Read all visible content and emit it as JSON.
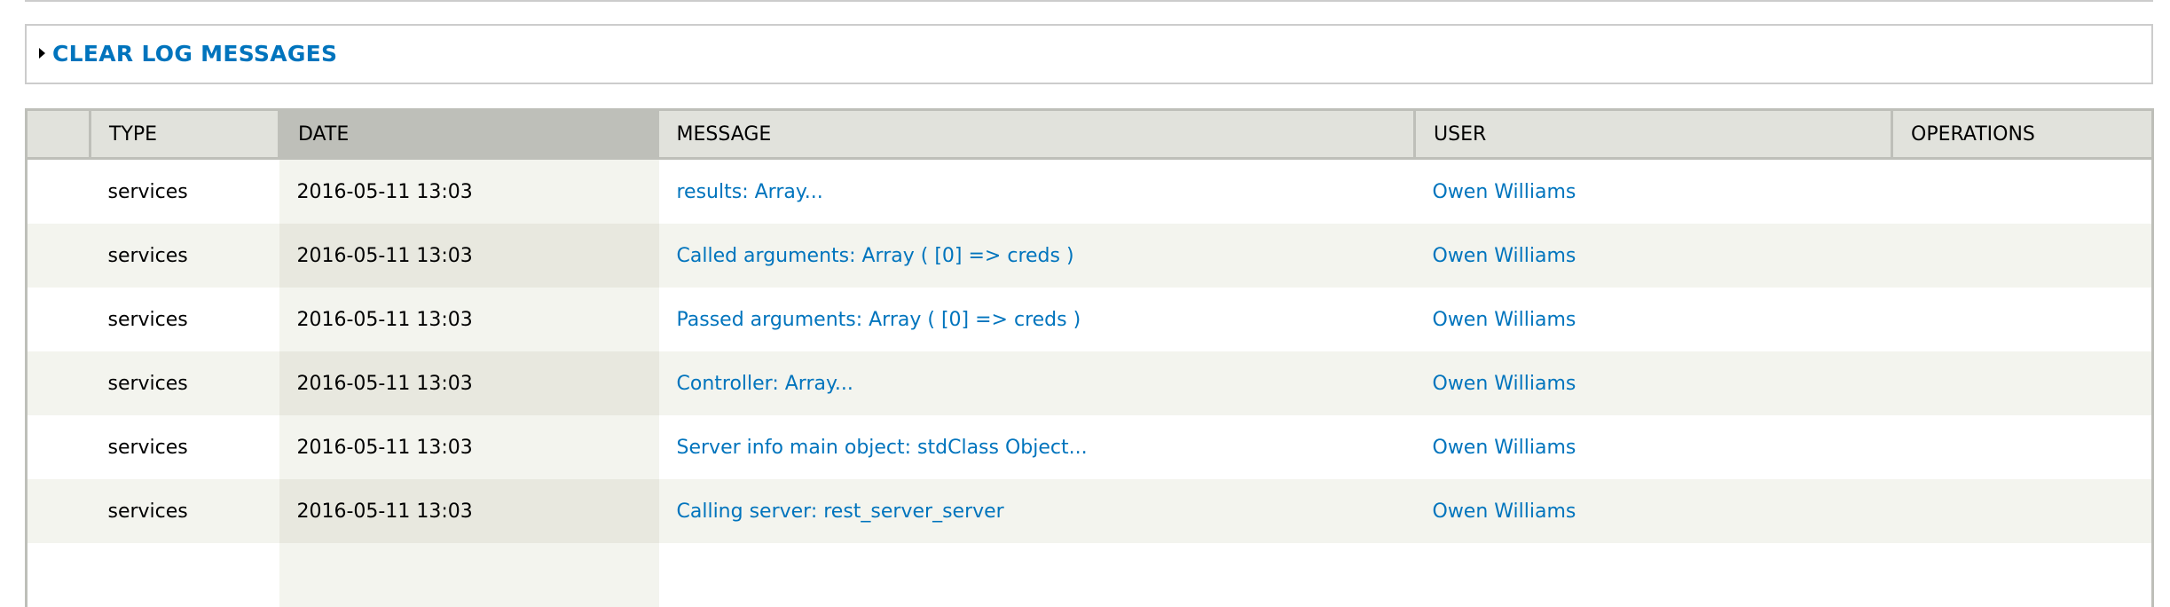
{
  "clear_log": {
    "label": "CLEAR LOG MESSAGES",
    "icon": "triangle-right-icon",
    "collapsed": true
  },
  "colors": {
    "link": "#0074bd",
    "header_bg": "#e1e2dc",
    "active_header_bg": "#bebfb9",
    "row_alt_bg": "#f3f4ee",
    "border": "#bebfb9"
  },
  "table": {
    "columns": [
      "",
      "TYPE",
      "DATE",
      "MESSAGE",
      "USER",
      "OPERATIONS"
    ],
    "sorted_column": "DATE",
    "rows": [
      {
        "type": "services",
        "date": "2016-05-11 13:03",
        "message": "results: Array...",
        "user": "Owen Williams",
        "operations": ""
      },
      {
        "type": "services",
        "date": "2016-05-11 13:03",
        "message": "Called arguments: Array ( [0] => creds )",
        "user": "Owen Williams",
        "operations": ""
      },
      {
        "type": "services",
        "date": "2016-05-11 13:03",
        "message": "Passed arguments: Array ( [0] => creds )",
        "user": "Owen Williams",
        "operations": ""
      },
      {
        "type": "services",
        "date": "2016-05-11 13:03",
        "message": "Controller: Array...",
        "user": "Owen Williams",
        "operations": ""
      },
      {
        "type": "services",
        "date": "2016-05-11 13:03",
        "message": "Server info main object: stdClass Object...",
        "user": "Owen Williams",
        "operations": ""
      },
      {
        "type": "services",
        "date": "2016-05-11 13:03",
        "message": "Calling server: rest_server_server",
        "user": "Owen Williams",
        "operations": ""
      }
    ]
  }
}
